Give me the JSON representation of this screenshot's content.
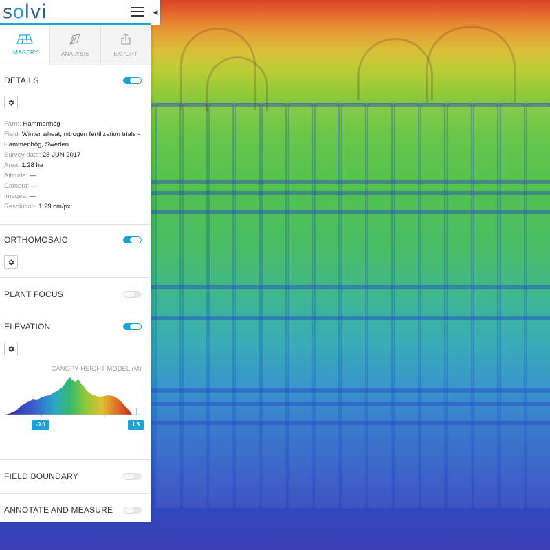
{
  "app": {
    "logo_prefix": "s",
    "logo_o": "o",
    "logo_suffix": "lvi"
  },
  "tabs": [
    {
      "label": "IMAGERY",
      "icon": "grid-icon",
      "active": true
    },
    {
      "label": "ANALYSIS",
      "icon": "layers-icon",
      "active": false
    },
    {
      "label": "EXPORT",
      "icon": "export-icon",
      "active": false
    }
  ],
  "sections": {
    "details": {
      "title": "DETAILS",
      "enabled": true,
      "fields": [
        {
          "key": "Farm:",
          "value": "Hammenhög"
        },
        {
          "key": "Field:",
          "value": "Winter wheat, nitrogen fertilization trials - Hammenhög, Sweden"
        },
        {
          "key": "Survey date:",
          "value": "28 JUN 2017"
        },
        {
          "key": "Area:",
          "value": "1.28 ha"
        },
        {
          "key": "Altitude:",
          "value": "—"
        },
        {
          "key": "Camera:",
          "value": "—"
        },
        {
          "key": "Images:",
          "value": "—"
        },
        {
          "key": "Resolution:",
          "value": "1.29 cm/px"
        }
      ]
    },
    "orthomosaic": {
      "title": "ORTHOMOSAIC",
      "enabled": true
    },
    "plant_focus": {
      "title": "PLANT FOCUS",
      "enabled": false
    },
    "elevation": {
      "title": "ELEVATION",
      "enabled": true,
      "legend_title": "CANOPY HEIGHT MODEL (M)",
      "min_label": "-0.0",
      "max_label": "1.5"
    },
    "field_boundary": {
      "title": "FIELD BOUNDARY",
      "enabled": false
    },
    "annotate": {
      "title": "ANNOTATE AND MEASURE",
      "enabled": false
    }
  },
  "colors": {
    "accent": "#1aa3d6",
    "logo": "#2a5d7c"
  }
}
